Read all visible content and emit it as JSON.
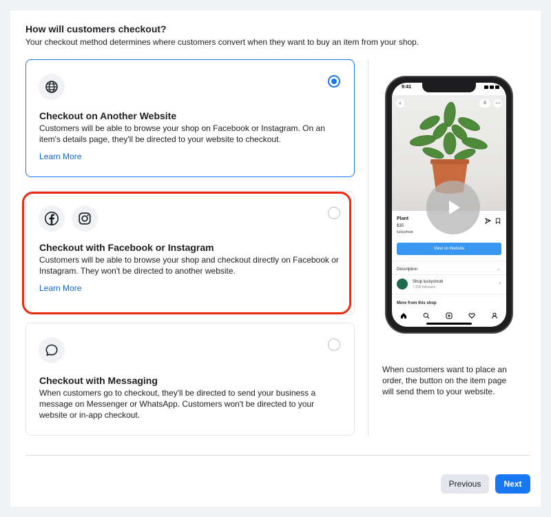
{
  "header": {
    "title": "How will customers checkout?",
    "subtitle": "Your checkout method determines where customers convert when they want to buy an item from your shop."
  },
  "options": [
    {
      "title": "Checkout on Another Website",
      "description": "Customers will be able to browse your shop on Facebook or Instagram. On an item's details page, they'll be directed to your website to checkout.",
      "link": "Learn More",
      "selected": true,
      "icons": [
        "globe-icon"
      ]
    },
    {
      "title": "Checkout with Facebook or Instagram",
      "description": "Customers will be able to browse your shop and checkout directly on Facebook or Instagram. They won't be directed to another website.",
      "link": "Learn More",
      "selected": false,
      "icons": [
        "facebook-icon",
        "instagram-icon"
      ]
    },
    {
      "title": "Checkout with Messaging",
      "description": "When customers go to checkout, they'll be directed to send your business a message on Messenger or WhatsApp. Customers won't be directed to your website or in-app checkout.",
      "selected": false,
      "icons": [
        "message-icon"
      ]
    }
  ],
  "preview": {
    "time": "9:41",
    "product_name": "Plant",
    "price": "$35",
    "shop_handle": "luckyshrub",
    "view_button": "View on Website",
    "description_label": "Description",
    "shop_name": "Shop luckyshrub",
    "followers": "7,209 followers",
    "more_label": "More from this shop",
    "cart_count": "0"
  },
  "side_text": "When customers want to place an order, the button on the item page will send them to your website.",
  "footer": {
    "previous": "Previous",
    "next": "Next"
  },
  "colors": {
    "accent": "#1877f2",
    "highlight": "#ec2a13",
    "link": "#1464d4"
  }
}
